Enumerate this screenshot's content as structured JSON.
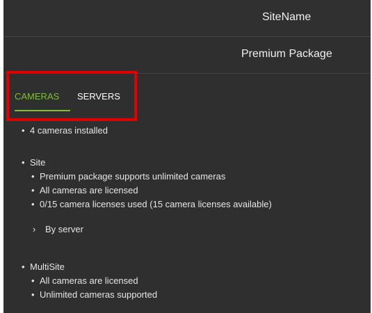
{
  "header": {
    "site_name": "SiteName",
    "package_name": "Premium Package"
  },
  "tabs": [
    {
      "label": "CAMERAS",
      "active": true
    },
    {
      "label": "SERVERS",
      "active": false
    }
  ],
  "summary": {
    "installed": "4 cameras installed"
  },
  "site": {
    "title": "Site",
    "items": [
      "Premium package supports unlimited cameras",
      "All cameras are licensed",
      "0/15 camera licenses used (15 camera licenses available)"
    ],
    "expander_label": "By server"
  },
  "multisite": {
    "title": "MultiSite",
    "items": [
      "All cameras are licensed",
      "Unlimited cameras supported"
    ]
  },
  "colors": {
    "accent": "#7fbd3a",
    "highlight_box": "#e00000",
    "background": "#2f2f2f"
  }
}
